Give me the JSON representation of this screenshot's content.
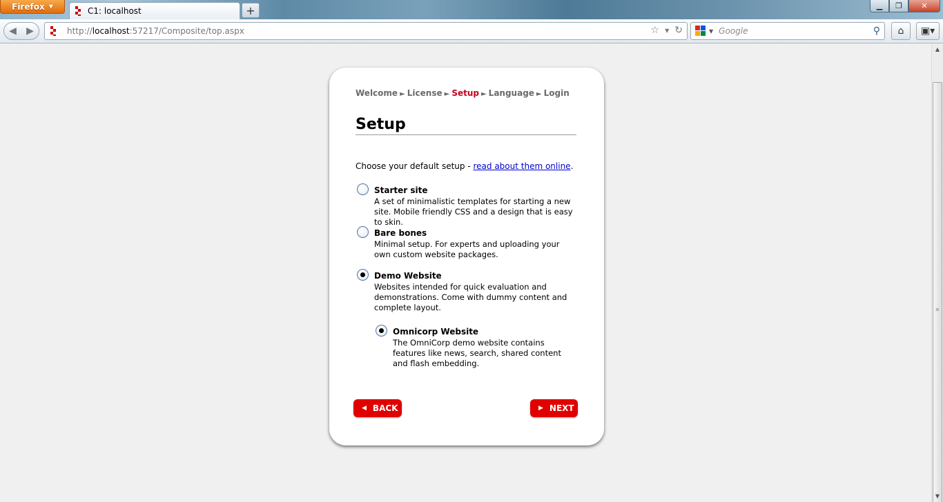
{
  "browser": {
    "menu_label": "Firefox",
    "tab_title": "C1: localhost",
    "new_tab_icon": "plus-icon",
    "url_prefix": "http://",
    "url_host": "localhost",
    "url_rest": ":57217/Composite/top.aspx",
    "search_placeholder": "Google"
  },
  "wizard": {
    "breadcrumb": [
      {
        "label": "Welcome",
        "active": false
      },
      {
        "label": "License",
        "active": false
      },
      {
        "label": "Setup",
        "active": true
      },
      {
        "label": "Language",
        "active": false
      },
      {
        "label": "Login",
        "active": false
      }
    ],
    "separator": "►",
    "title": "Setup",
    "intro_text": "Choose your default setup - ",
    "intro_link": "read about them online",
    "intro_end": ".",
    "options": [
      {
        "title": "Starter site",
        "desc": "A set of minimalistic templates for starting a new site. Mobile friendly CSS and a design that is easy to skin.",
        "checked": false
      },
      {
        "title": "Bare bones",
        "desc": "Minimal setup. For experts and uploading your own custom website packages.",
        "checked": false
      },
      {
        "title": "Demo Website",
        "desc": "Websites intended for quick evaluation and demonstrations. Come with dummy content and complete layout.",
        "checked": true
      }
    ],
    "sub_option": {
      "title": "Omnicorp Website",
      "desc": "The OmniCorp demo website contains features like news, search, shared content and flash embedding.",
      "checked": true
    },
    "back_label": "BACK",
    "next_label": "NEXT"
  },
  "colors": {
    "accent_red": "#e00000",
    "active_step": "#c8001e",
    "link": "#0000cc"
  }
}
